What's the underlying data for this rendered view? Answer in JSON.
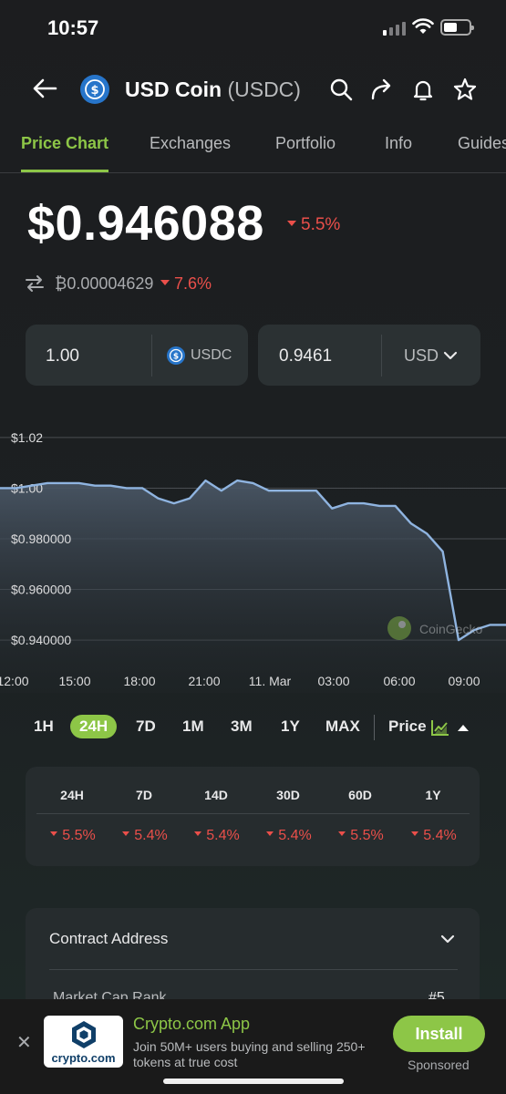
{
  "status_bar": {
    "time": "10:57"
  },
  "header": {
    "coin_name": "USD Coin",
    "coin_symbol": "(USDC)"
  },
  "tabs": [
    {
      "label": "Price Chart",
      "active": true
    },
    {
      "label": "Exchanges"
    },
    {
      "label": "Portfolio"
    },
    {
      "label": "Info"
    },
    {
      "label": "Guides"
    }
  ],
  "price": {
    "usd": "$0.946088",
    "change_24h": "5.5%",
    "btc": "₿0.00004629",
    "btc_change": "7.6%"
  },
  "converter": {
    "amount": "1.00",
    "from_symbol": "USDC",
    "result": "0.9461",
    "to_currency": "USD"
  },
  "chart": {
    "y_labels": [
      "$1.02",
      "$1.00",
      "$0.980000",
      "$0.960000",
      "$0.940000"
    ],
    "x_labels": [
      "12:00",
      "15:00",
      "18:00",
      "21:00",
      "11. Mar",
      "03:00",
      "06:00",
      "09:00"
    ],
    "watermark": "CoinGecko",
    "line_color": "#8fb4e0"
  },
  "chart_data": {
    "type": "area",
    "x": [
      "12:00",
      "12:45",
      "13:30",
      "14:15",
      "15:00",
      "15:45",
      "16:30",
      "17:15",
      "18:00",
      "18:45",
      "19:30",
      "20:15",
      "21:00",
      "21:45",
      "22:30",
      "23:15",
      "00:00",
      "00:45",
      "01:30",
      "02:15",
      "03:00",
      "03:45",
      "04:30",
      "05:15",
      "06:00",
      "06:45",
      "07:30",
      "08:15",
      "08:40",
      "09:00",
      "09:30",
      "10:00",
      "10:30"
    ],
    "y": [
      1.0,
      1.0,
      1.001,
      1.002,
      1.002,
      1.002,
      1.001,
      1.001,
      1.0,
      1.0,
      0.996,
      0.994,
      0.996,
      1.003,
      0.999,
      1.003,
      1.002,
      0.999,
      0.999,
      0.999,
      0.999,
      0.992,
      0.994,
      0.994,
      0.993,
      0.993,
      0.986,
      0.982,
      0.975,
      0.94,
      0.944,
      0.946,
      0.946
    ],
    "ylim": [
      0.935,
      1.025
    ],
    "y_ticks": [
      1.02,
      1.0,
      0.98,
      0.96,
      0.94
    ],
    "grid": true,
    "legend": "none"
  },
  "ranges": [
    {
      "label": "1H"
    },
    {
      "label": "24H",
      "active": true
    },
    {
      "label": "7D"
    },
    {
      "label": "1M"
    },
    {
      "label": "3M"
    },
    {
      "label": "1Y"
    },
    {
      "label": "MAX"
    }
  ],
  "chart_mode": {
    "label": "Price"
  },
  "performance": {
    "headers": [
      "24H",
      "7D",
      "14D",
      "30D",
      "60D",
      "1Y"
    ],
    "values": [
      "5.5%",
      "5.4%",
      "5.4%",
      "5.4%",
      "5.5%",
      "5.4%"
    ]
  },
  "contract": {
    "title": "Contract Address",
    "row_label": "Market Cap Rank",
    "row_value": "#5"
  },
  "ad": {
    "logo_text": "crypto.com",
    "title": "Crypto.com App",
    "subtitle": "Join 50M+ users buying and selling 250+ tokens at true cost",
    "button": "Install",
    "sponsored": "Sponsored"
  },
  "colors": {
    "accent": "#8dc647",
    "negative": "#ea4f4a",
    "background": "#1c1d1f"
  }
}
